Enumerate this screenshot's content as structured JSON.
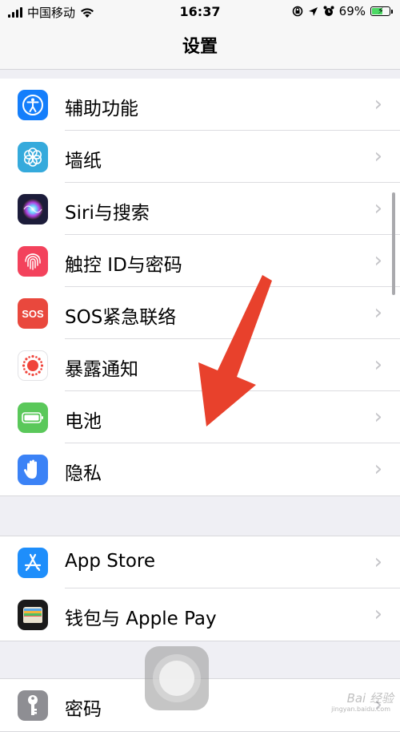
{
  "status_bar": {
    "carrier": "中国移动",
    "time": "16:37",
    "battery_percent": "69%",
    "battery_level": 0.69
  },
  "nav": {
    "title": "设置"
  },
  "group1": [
    {
      "label": "辅助功能",
      "icon": "accessibility-icon",
      "color": "#147efb"
    },
    {
      "label": "墙纸",
      "icon": "wallpaper-icon",
      "color": "#35aadc"
    },
    {
      "label": "Siri与搜索",
      "icon": "siri-icon",
      "color": "#1c1c3a"
    },
    {
      "label": "触控 ID与密码",
      "icon": "fingerprint-icon",
      "color": "#f3425c"
    },
    {
      "label": "SOS紧急联络",
      "icon": "sos-icon",
      "color": "#e9483d"
    },
    {
      "label": "暴露通知",
      "icon": "exposure-icon",
      "color": "#ffffff"
    },
    {
      "label": "电池",
      "icon": "battery-icon",
      "color": "#5ac85a"
    },
    {
      "label": "隐私",
      "icon": "privacy-hand-icon",
      "color": "#3b82f6"
    }
  ],
  "group2": [
    {
      "label": "App Store",
      "icon": "app-store-icon",
      "color": "#1e8efb"
    },
    {
      "label": "钱包与 Apple Pay",
      "icon": "wallet-icon",
      "color": "#1a1a1a"
    }
  ],
  "group3": [
    {
      "label": "密码",
      "icon": "key-icon",
      "color": "#8e8e93"
    }
  ],
  "icons_text": {
    "sos": "SOS"
  },
  "watermark": {
    "text": "Bai 经验",
    "sub": "jingyan.baidu.com"
  }
}
